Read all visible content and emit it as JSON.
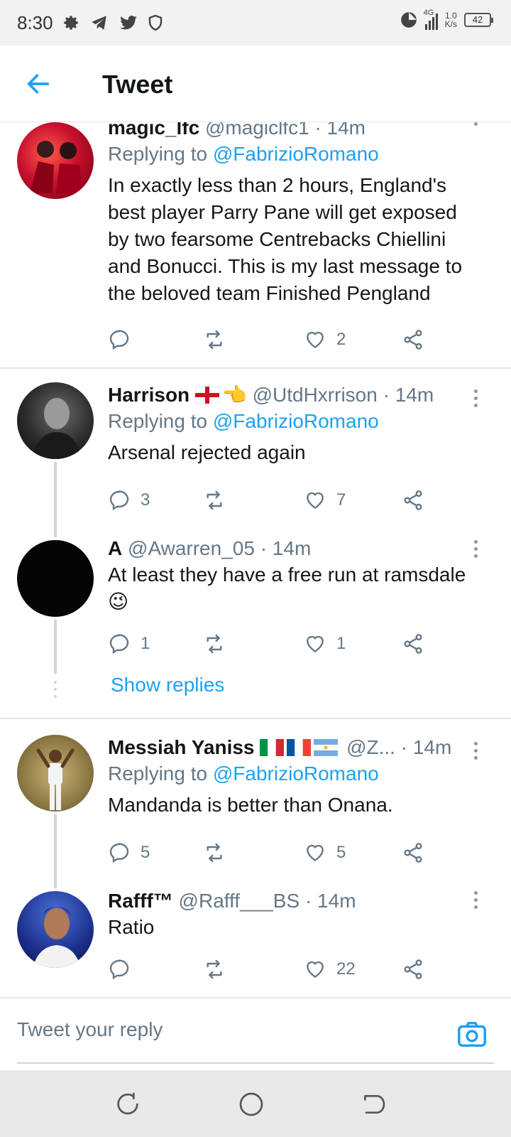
{
  "status_bar": {
    "time": "8:30",
    "network": "4G",
    "speed_value": "1.0",
    "speed_unit": "K/s",
    "battery": "42"
  },
  "header": {
    "title": "Tweet"
  },
  "tweets": [
    {
      "name": "magic_lfc",
      "handle": "@magiclfc1",
      "time": "· 14m",
      "replying_prefix": "Replying to",
      "replying_to": "@FabrizioRomano",
      "text_lines": [
        "In exactly less than 2 hours, England's",
        "best player Parry Pane will get exposed",
        "by two fearsome Centrebacks Chiellini",
        "and Bonucci. This is my last message to",
        "the beloved team Finished Pengland"
      ],
      "replies": "",
      "likes": "2"
    },
    {
      "name": "Harrison",
      "emoji": "👈",
      "handle": "@UtdHxrrison",
      "time": "· 14m",
      "replying_prefix": "Replying to",
      "replying_to": "@FabrizioRomano",
      "text_lines": [
        "Arsenal rejected again"
      ],
      "replies": "3",
      "likes": "7"
    },
    {
      "name": "A",
      "handle": "@Awarren_05",
      "time": "· 14m",
      "text_lines": [
        "At least they have a free run at ramsdale"
      ],
      "emoji": "😉",
      "replies": "1",
      "likes": "1"
    },
    {
      "name": "Messiah Yaniss",
      "handle": "@Z...",
      "time": "· 14m",
      "replying_prefix": "Replying to",
      "replying_to": "@FabrizioRomano",
      "text_lines": [
        "Mandanda is better than Onana."
      ],
      "replies": "5",
      "likes": "5"
    },
    {
      "name": "Rafff™",
      "handle": "@Rafff___BS",
      "time": "· 14m",
      "text_lines": [
        "Ratio"
      ],
      "replies": "",
      "likes": "22"
    }
  ],
  "show_replies": "Show replies",
  "reply_bar": {
    "placeholder": "Tweet your reply"
  },
  "colors": {
    "accent": "#1da1f2",
    "muted": "#657786",
    "divider": "#e1e8ed"
  }
}
